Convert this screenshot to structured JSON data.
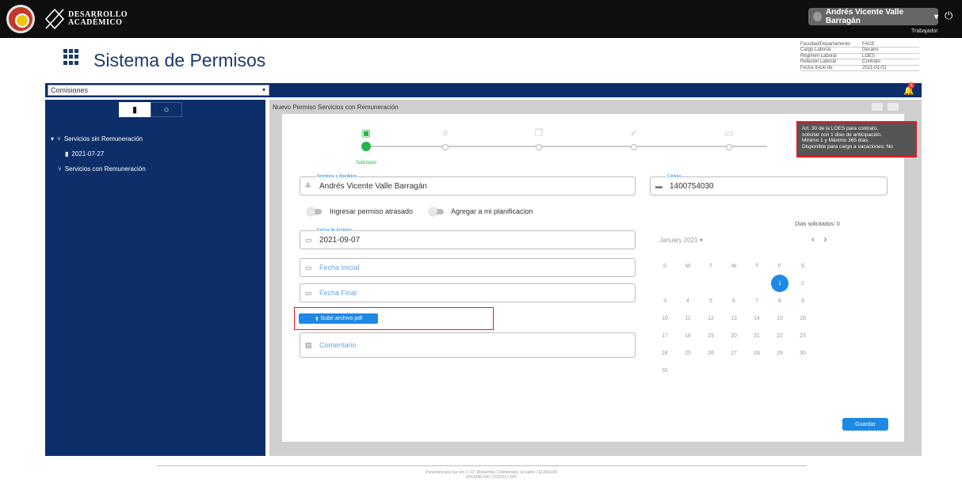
{
  "header": {
    "logo_text_line1": "DESARROLLO",
    "logo_text_line2": "ACADÉMICO",
    "user_name": "Andrés Vicente Valle Barragán",
    "user_role": "Trabajador"
  },
  "app": {
    "title": "Sistema de Permisos"
  },
  "info": [
    {
      "label": "Facultad/Departamento",
      "value": "FACE"
    },
    {
      "label": "Cargo Laboral",
      "value": "Decano"
    },
    {
      "label": "Regimen Laboral",
      "value": "LOES"
    },
    {
      "label": "Relación Laboral",
      "value": "Contrato"
    },
    {
      "label": "Fecha Inicio de",
      "value": "2021-01-01"
    }
  ],
  "toolbar": {
    "select_value": "Comisiones",
    "notification_count": "1"
  },
  "sidebar": {
    "items": [
      {
        "label": "Servicios sin Remuneración"
      },
      {
        "label": "2021-07-27"
      },
      {
        "label": "Servicios con Remuneración"
      }
    ]
  },
  "panel": {
    "title": "Nuevo Permiso Servicios con Remuneración"
  },
  "stepper": {
    "steps": [
      {
        "label": "Solicitado",
        "active": true
      },
      {
        "label": "",
        "active": false
      },
      {
        "label": "",
        "active": false
      },
      {
        "label": "",
        "active": false
      },
      {
        "label": "",
        "active": false
      },
      {
        "label": "",
        "active": false
      }
    ]
  },
  "tooltip": {
    "line1": "Art. 30 de la LOES para contrato,",
    "line2": "solicitar con 1 días de anticipación.",
    "line3": "Mínimo 1 y Máximo 365 días.",
    "line4": "Disponible para cargo a vacaciones: No"
  },
  "form": {
    "name_label": "Nombres y Apellidos",
    "name_value": "Andrés Vicente Valle Barragán",
    "cedula_label": "Cédula",
    "cedula_value": "1400754030",
    "toggle1_label": "Ingresar permiso atrasado",
    "toggle2_label": "Agregar a mi planificacion",
    "emission_label": "Fecha de Emisión",
    "emission_value": "2021-09-07",
    "start_placeholder": "Fecha Inicial",
    "end_placeholder": "Fecha Final",
    "upload_label": "Subir archivo pdf",
    "comment_placeholder": "Comentario",
    "save_label": "Guardar"
  },
  "calendar": {
    "dias_label": "Días solicitados: 0",
    "month_label": "January 2021",
    "weekdays": [
      "S",
      "M",
      "T",
      "W",
      "T",
      "F",
      "S"
    ],
    "selected_day": "1"
  },
  "footer": {
    "line1": "Panamericana Sur km 1 1/2. Riobamba, Chimborazo, Ecuador | EC060150",
    "line2": "(03)2998-200 | (03)2317-001"
  },
  "colors": {
    "navy": "#0c2f6a",
    "accent": "#1e88e5",
    "success": "#23b54b",
    "highlight": "#e31b23"
  }
}
